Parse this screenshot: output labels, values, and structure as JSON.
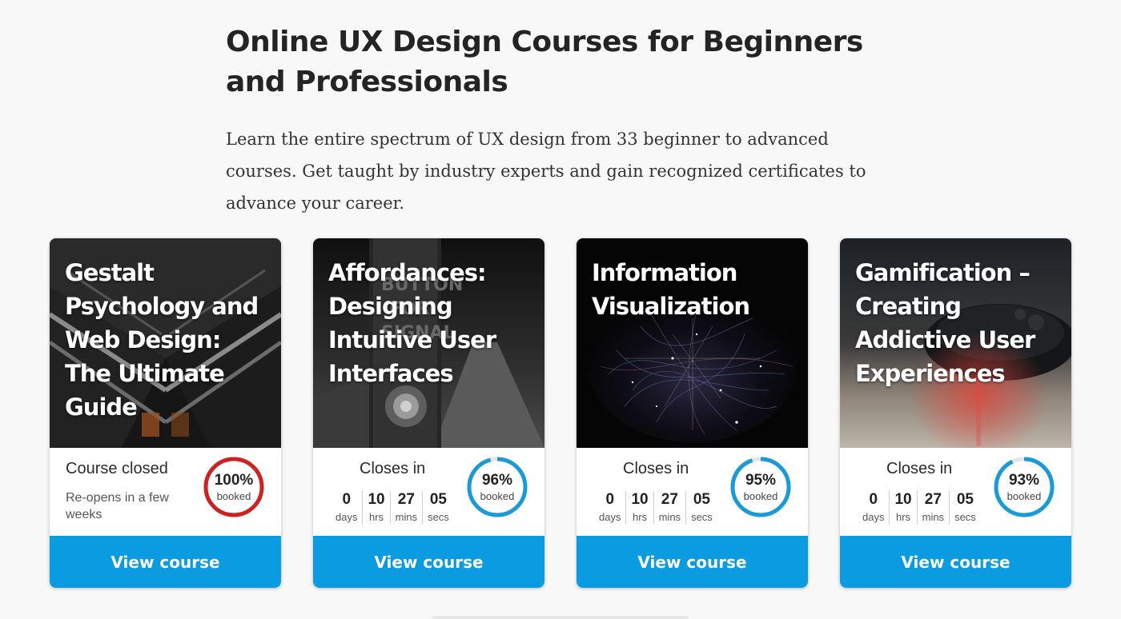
{
  "header": {
    "title": "Online UX Design Courses for Beginners and Professionals",
    "lead": "Learn the entire spectrum of UX design from 33 beginner to advanced courses. Get taught by industry experts and gain recognized certificates to advance your career."
  },
  "colors": {
    "accent": "#0a9be0",
    "ring_open": "#1a9ad6",
    "ring_closed": "#cc2222"
  },
  "cards": [
    {
      "title": "Gestalt Psychology and Web Design: The Ultimate Guide",
      "status": "Course closed",
      "note": "Re-opens in a few weeks",
      "booked_percent": "100%",
      "booked_label": "booked",
      "booked_fraction": 1.0,
      "button": "View course"
    },
    {
      "title": "Affordances: Designing Intuitive User Interfaces",
      "status": "Closes in",
      "timer": [
        {
          "value": "0",
          "unit": "days"
        },
        {
          "value": "10",
          "unit": "hrs"
        },
        {
          "value": "27",
          "unit": "mins"
        },
        {
          "value": "05",
          "unit": "secs"
        }
      ],
      "booked_percent": "96%",
      "booked_label": "booked",
      "booked_fraction": 0.96,
      "button": "View course"
    },
    {
      "title": "Information Visualization",
      "status": "Closes in",
      "timer": [
        {
          "value": "0",
          "unit": "days"
        },
        {
          "value": "10",
          "unit": "hrs"
        },
        {
          "value": "27",
          "unit": "mins"
        },
        {
          "value": "05",
          "unit": "secs"
        }
      ],
      "booked_percent": "95%",
      "booked_label": "booked",
      "booked_fraction": 0.95,
      "button": "View course"
    },
    {
      "title": "Gamification – Creating Addictive User Experiences",
      "status": "Closes in",
      "timer": [
        {
          "value": "0",
          "unit": "days"
        },
        {
          "value": "10",
          "unit": "hrs"
        },
        {
          "value": "27",
          "unit": "mins"
        },
        {
          "value": "05",
          "unit": "secs"
        }
      ],
      "booked_percent": "93%",
      "booked_label": "booked",
      "booked_fraction": 0.93,
      "button": "View course"
    }
  ]
}
